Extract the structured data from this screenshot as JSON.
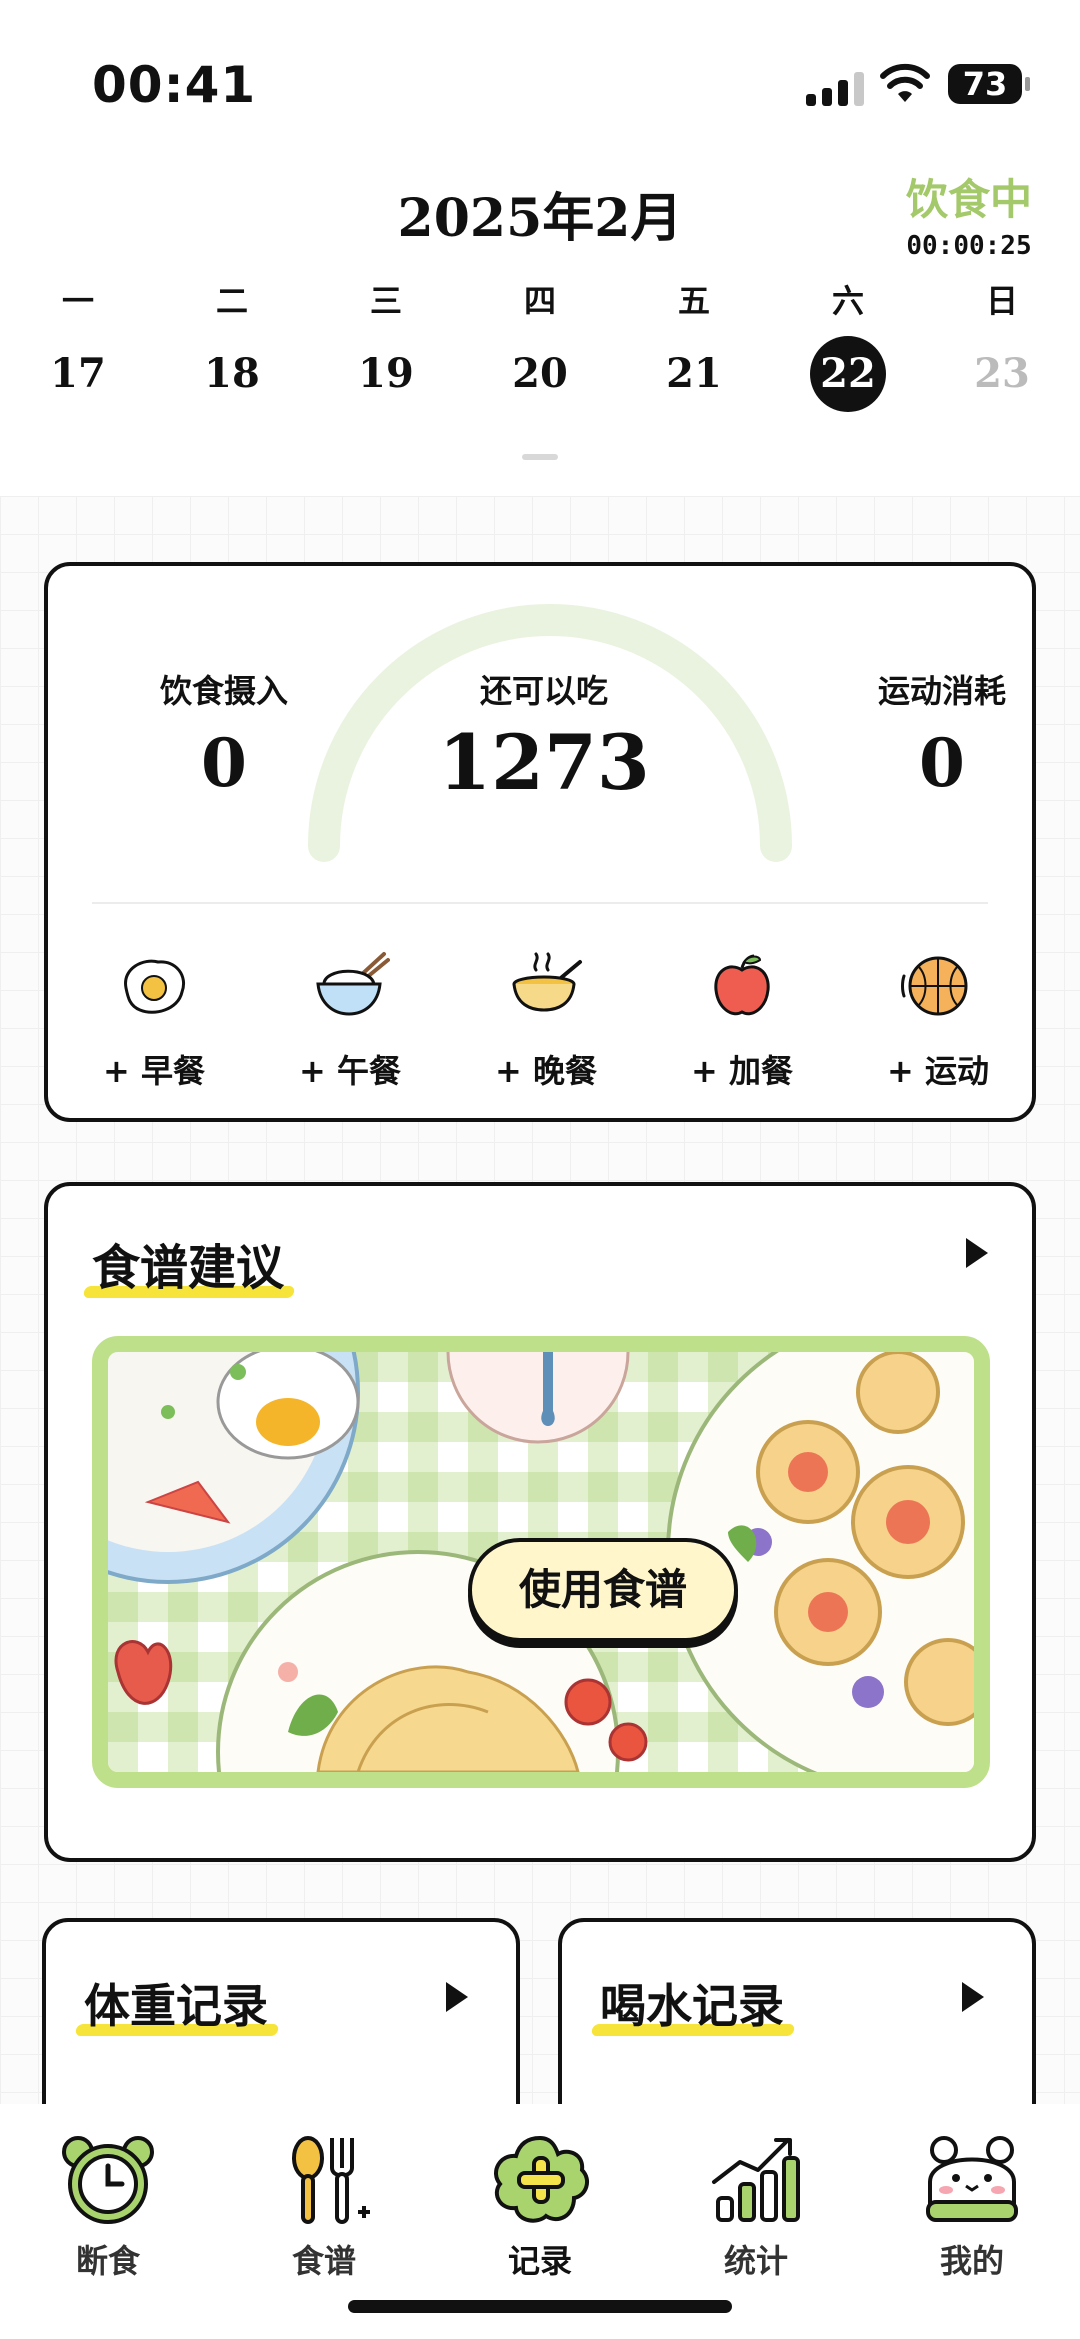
{
  "status_bar": {
    "time": "00:41",
    "battery": "73"
  },
  "calendar": {
    "month_title": "2025年2月",
    "fasting_label": "饮食中",
    "fasting_timer": "00:00:25",
    "weekdays": [
      "一",
      "二",
      "三",
      "四",
      "五",
      "六",
      "日"
    ],
    "dates": [
      "17",
      "18",
      "19",
      "20",
      "21",
      "22",
      "23"
    ],
    "selected_date": "22"
  },
  "summary": {
    "intake_label": "饮食摄入",
    "intake_value": "0",
    "remaining_label": "还可以吃",
    "remaining_value": "1273",
    "exercise_label": "运动消耗",
    "exercise_value": "0",
    "gauge_fraction": 0,
    "meals": [
      {
        "label": "+ 早餐",
        "icon": "fried-egg-icon"
      },
      {
        "label": "+ 午餐",
        "icon": "rice-bowl-icon"
      },
      {
        "label": "+ 晚餐",
        "icon": "soup-bowl-icon"
      },
      {
        "label": "+ 加餐",
        "icon": "apple-icon"
      },
      {
        "label": "+ 运动",
        "icon": "basketball-icon"
      }
    ]
  },
  "recipe": {
    "title": "食谱建议",
    "use_button": "使用食谱"
  },
  "weight": {
    "title": "体重记录"
  },
  "water": {
    "title": "喝水记录"
  },
  "tabbar": {
    "items": [
      {
        "label": "断食",
        "icon": "alarm-clock-icon"
      },
      {
        "label": "食谱",
        "icon": "spoon-fork-icon"
      },
      {
        "label": "记录",
        "icon": "add-record-icon"
      },
      {
        "label": "统计",
        "icon": "bar-chart-icon"
      },
      {
        "label": "我的",
        "icon": "bear-avatar-icon"
      }
    ],
    "active_index": 2
  },
  "colors": {
    "accent_green": "#a3c96a",
    "gauge_track": "#eaf3df",
    "highlight_yellow": "#f6e43a"
  }
}
